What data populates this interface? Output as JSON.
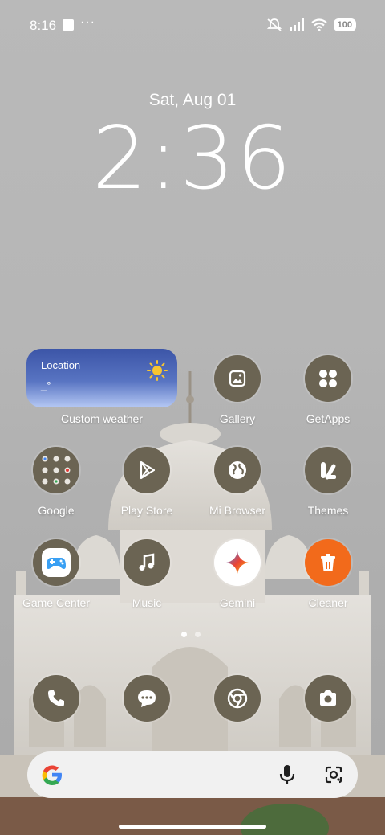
{
  "status_bar": {
    "time": "8:16",
    "more": "···",
    "battery": "100",
    "icons": [
      "notification-square-icon",
      "mute-icon",
      "signal-icon",
      "wifi-icon",
      "battery-icon"
    ]
  },
  "lock_clock": {
    "date": "Sat, Aug 01",
    "time": "2:36"
  },
  "weather_widget": {
    "location": "Location",
    "temperature": "_°",
    "label": "Custom weather",
    "icon": "sun-icon"
  },
  "apps": {
    "gallery": "Gallery",
    "getapps": "GetApps",
    "google": "Google",
    "play_store": "Play Store",
    "mi_browser": "Mi Browser",
    "themes": "Themes",
    "game_center": "Game Center",
    "music": "Music",
    "gemini": "Gemini",
    "cleaner": "Cleaner"
  },
  "dock": [
    "phone-icon",
    "messages-icon",
    "chrome-icon",
    "camera-icon"
  ],
  "page_indicator": {
    "pages": 2,
    "current": 1
  },
  "search_bar": {
    "icons": [
      "google-g-icon",
      "microphone-icon",
      "google-lens-icon"
    ]
  },
  "colors": {
    "icon_bg": "#6b6453",
    "cleaner_accent": "#f26a1b",
    "widget_top": "#3c55a7",
    "widget_bottom": "#b5c8f4"
  }
}
